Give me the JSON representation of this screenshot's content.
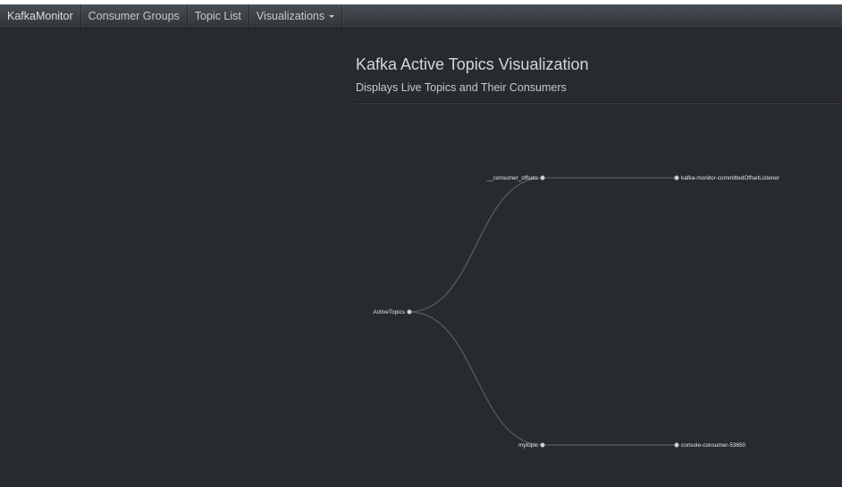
{
  "navbar": {
    "brand": "KafkaMonitor",
    "items": [
      {
        "label": "Consumer Groups"
      },
      {
        "label": "Topic List"
      },
      {
        "label": "Visualizations"
      }
    ]
  },
  "header": {
    "title": "Kafka Active Topics Visualization",
    "subtitle": "Displays Live Topics and Their Consumers"
  },
  "tree": {
    "root": "ActiveTopics",
    "topics": [
      {
        "name": "__consumer_offsets",
        "consumers": [
          "kafka-monitor-committedOffsetListener"
        ]
      },
      {
        "name": "mytopic",
        "consumers": [
          "console-consumer-53650"
        ]
      }
    ]
  },
  "colors": {
    "background": "#272b30",
    "navbar": "#3a3f44",
    "link": "#5a5e63",
    "node": "#d8d8d8"
  }
}
